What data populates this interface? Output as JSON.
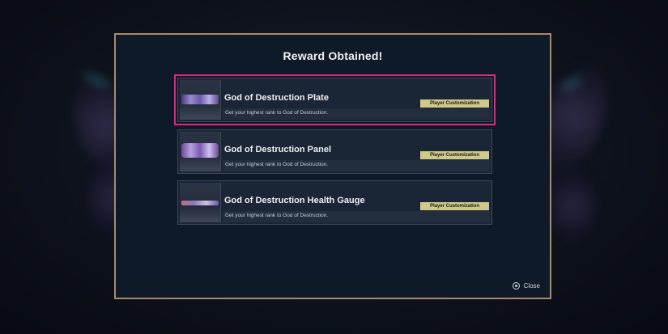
{
  "dialog": {
    "title": "Reward Obtained!",
    "close_label": "Close",
    "close_icon": "circle-button-icon"
  },
  "rewards": [
    {
      "name": "God of Destruction Plate",
      "description": "Get your highest rank to God of Destruction.",
      "tag": "Player Customization",
      "thumbnail": "plate-thumbnail",
      "selected": true
    },
    {
      "name": "God of Destruction Panel",
      "description": "Get your highest rank to God of Destruction.",
      "tag": "Player Customization",
      "thumbnail": "panel-thumbnail",
      "selected": false
    },
    {
      "name": "God of Destruction Health Gauge",
      "description": "Get your highest rank to God of Destruction.",
      "tag": "Player Customization",
      "thumbnail": "gauge-thumbnail",
      "selected": false
    }
  ],
  "colors": {
    "selection_outline": "#e0287f",
    "modal_border": "#a88a6a",
    "tag_background": "#cfc98a"
  }
}
